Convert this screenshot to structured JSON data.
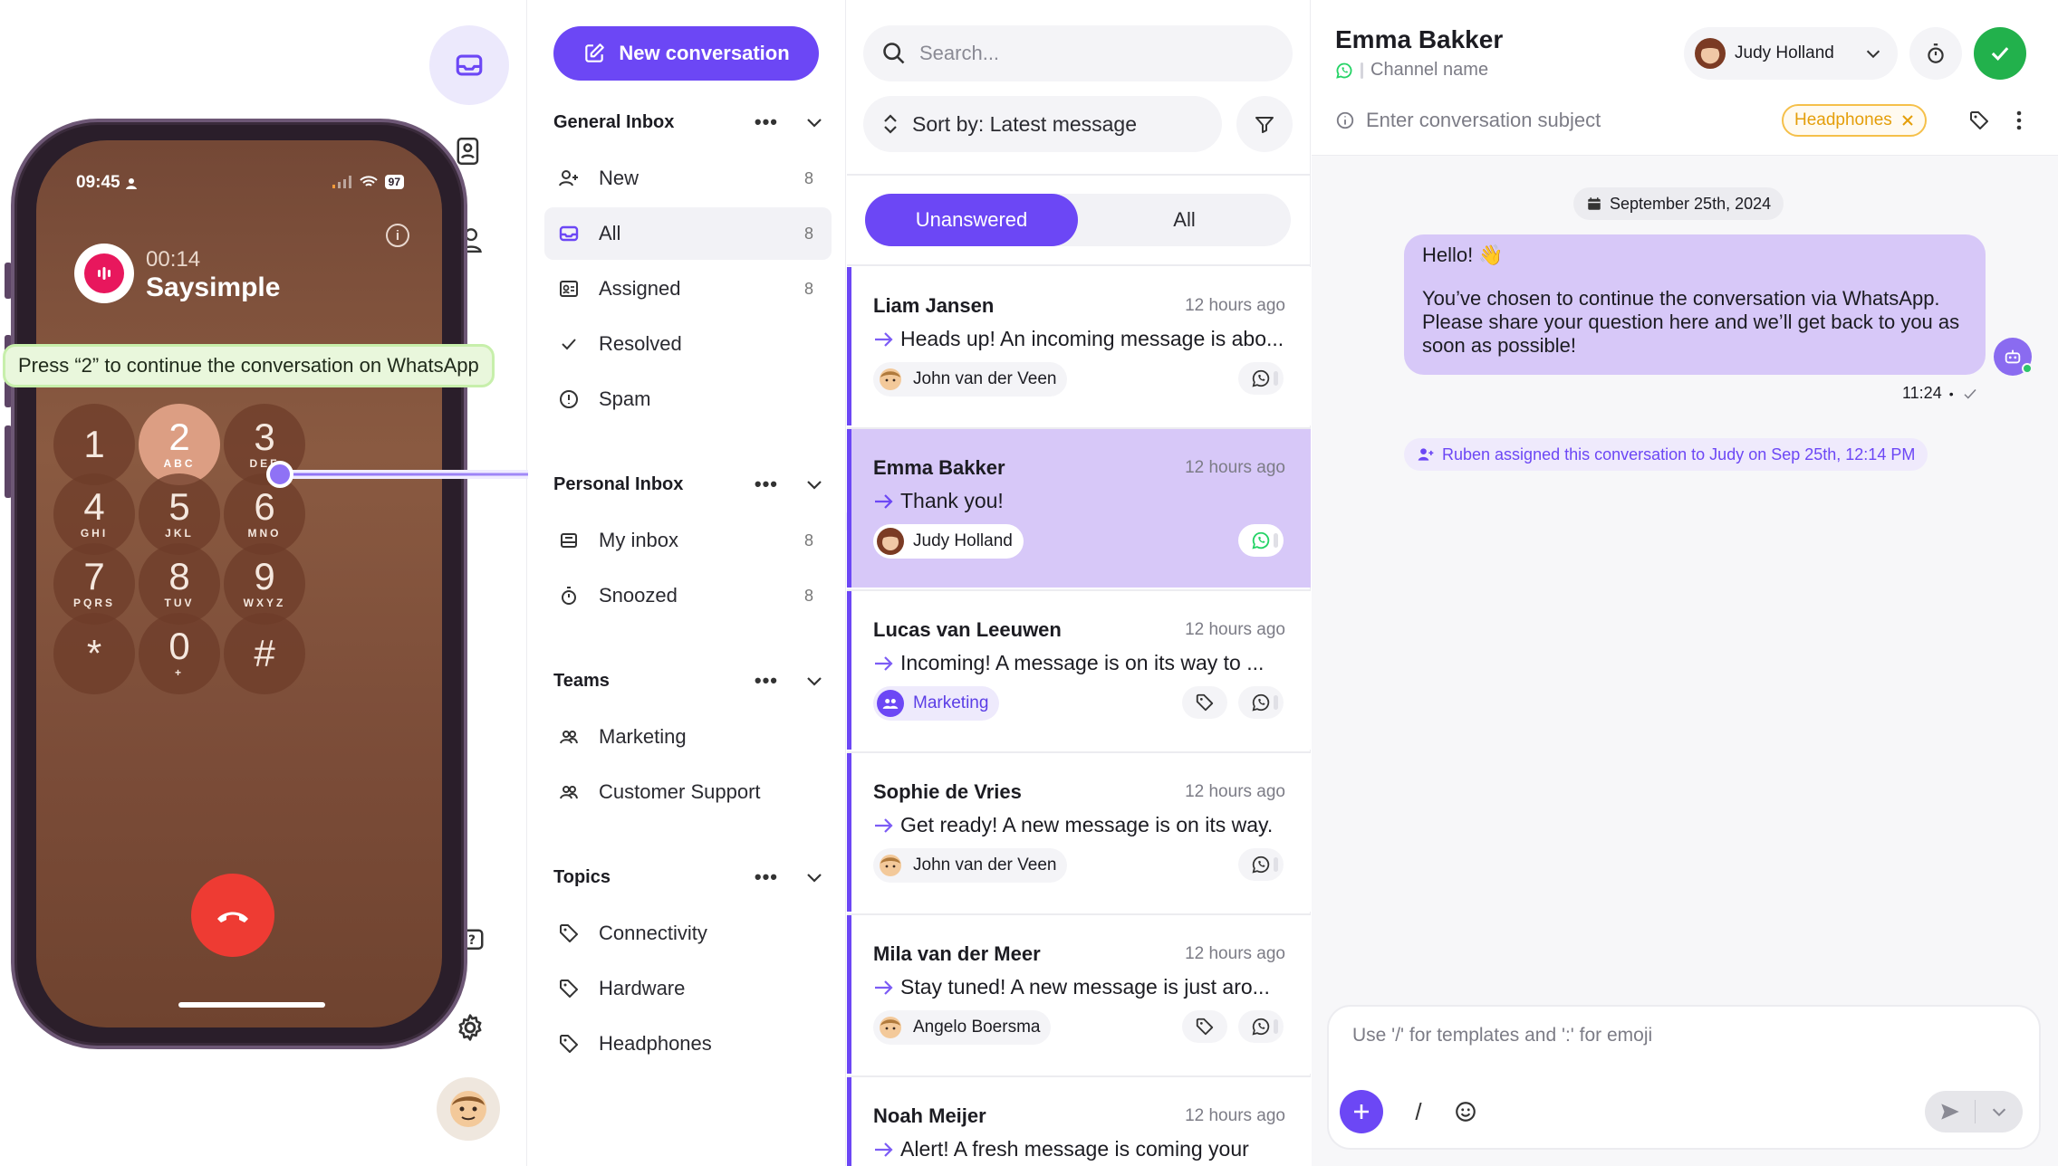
{
  "phone": {
    "time": "09:45",
    "battery": "97",
    "call_timer": "00:14",
    "caller_name": "Saysimple",
    "banner": "Press “2” to continue the conversation on WhatsApp",
    "keys": [
      {
        "digit": "1",
        "letters": ""
      },
      {
        "digit": "2",
        "letters": "ABC"
      },
      {
        "digit": "3",
        "letters": "DEF"
      },
      {
        "digit": "4",
        "letters": "GHI"
      },
      {
        "digit": "5",
        "letters": "JKL"
      },
      {
        "digit": "6",
        "letters": "MNO"
      },
      {
        "digit": "7",
        "letters": "PQRS"
      },
      {
        "digit": "8",
        "letters": "TUV"
      },
      {
        "digit": "9",
        "letters": "WXYZ"
      },
      {
        "digit": "*",
        "letters": ""
      },
      {
        "digit": "0",
        "letters": "+"
      },
      {
        "digit": "#",
        "letters": ""
      }
    ]
  },
  "inbox": {
    "new_conversation": "New conversation",
    "sections": {
      "general": {
        "title": "General Inbox",
        "items": [
          {
            "label": "New",
            "count": "8"
          },
          {
            "label": "All",
            "count": "8"
          },
          {
            "label": "Assigned",
            "count": "8"
          },
          {
            "label": "Resolved",
            "count": ""
          },
          {
            "label": "Spam",
            "count": ""
          }
        ]
      },
      "personal": {
        "title": "Personal Inbox",
        "items": [
          {
            "label": "My inbox",
            "count": "8"
          },
          {
            "label": "Snoozed",
            "count": "8"
          }
        ]
      },
      "teams": {
        "title": "Teams",
        "items": [
          {
            "label": "Marketing"
          },
          {
            "label": "Customer Support"
          }
        ]
      },
      "topics": {
        "title": "Topics",
        "items": [
          {
            "label": "Connectivity"
          },
          {
            "label": "Hardware"
          },
          {
            "label": "Headphones"
          }
        ]
      }
    }
  },
  "list": {
    "search_placeholder": "Search...",
    "sort_label": "Sort by: Latest message",
    "tabs": [
      "Unanswered",
      "All"
    ],
    "conversations": [
      {
        "name": "Liam Jansen",
        "time": "12 hours ago",
        "message": "Heads up! An incoming message is abo...",
        "chip": "John van der Veen"
      },
      {
        "name": "Emma Bakker",
        "time": "12 hours ago",
        "message": "Thank you!",
        "chip": "Judy Holland"
      },
      {
        "name": "Lucas van Leeuwen",
        "time": "12 hours ago",
        "message": "Incoming! A message is on its way to ...",
        "chip": "Marketing"
      },
      {
        "name": "Sophie de Vries",
        "time": "12 hours ago",
        "message": "Get ready! A new message is on its way.",
        "chip": "John van der Veen"
      },
      {
        "name": "Mila van der Meer",
        "time": "12 hours ago",
        "message": "Stay tuned! A new message is just aro...",
        "chip": "Angelo Boersma"
      },
      {
        "name": "Noah Meijer",
        "time": "12 hours ago",
        "message": "Alert! A fresh message is coming your",
        "chip": ""
      }
    ]
  },
  "chat": {
    "contact_name": "Emma Bakker",
    "channel_name": "Channel name",
    "assignee": "Judy Holland",
    "subject_placeholder": "Enter conversation subject",
    "tag": "Headphones",
    "date": "September 25th, 2024",
    "bubble_line1": "Hello! 👋",
    "bubble_line2": "You’ve chosen to continue the conversation via WhatsApp. Please share your question here and we’ll get back to you as soon as possible!",
    "message_time": "11:24",
    "system_message": "Ruben assigned this conversation to Judy on Sep 25th, 12:14 PM",
    "composer_placeholder": "Use '/' for templates and ':' for emoji",
    "slash": "/"
  },
  "colors": {
    "accent": "#6c47f5",
    "selected": "#d7c8f8",
    "whatsapp": "#25d366",
    "resolve": "#22b14c",
    "tag": "#f5c04a",
    "end_call": "#ee3b33"
  }
}
